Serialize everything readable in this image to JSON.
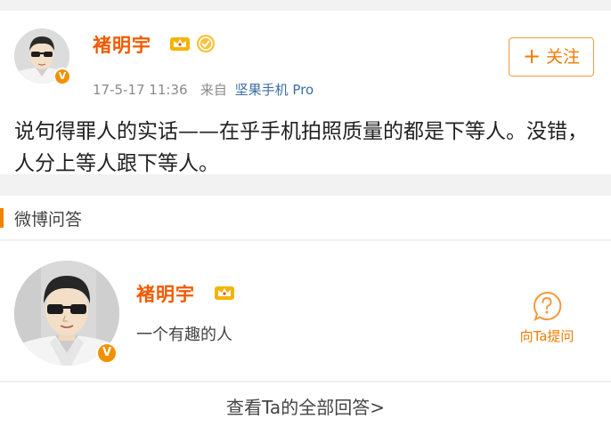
{
  "post": {
    "author": "褚明宇",
    "time": "17-5-17 11:36",
    "source_prefix": "来自",
    "source": "坚果手机 Pro",
    "follow_label": "关注",
    "text": "说句得罪人的实话——在乎手机拍照质量的都是下等人。没错，人分上等人跟下等人。",
    "verified_badge": "V"
  },
  "qa": {
    "section_title": "微博问答",
    "name": "褚明宇",
    "bio": "一个有趣的人",
    "ask_label": "向Ta提问",
    "view_all": "查看Ta的全部回答>",
    "verified_badge": "V"
  },
  "icons": {
    "crown": "crown-icon",
    "medal": "medal-icon",
    "question": "question-bubble-icon",
    "plus": "plus-icon"
  },
  "colors": {
    "accent": "#f07c00",
    "name": "#f25a00",
    "link": "#3a6ea5",
    "meta": "#8a8a8a",
    "background": "#f2f2f2"
  }
}
